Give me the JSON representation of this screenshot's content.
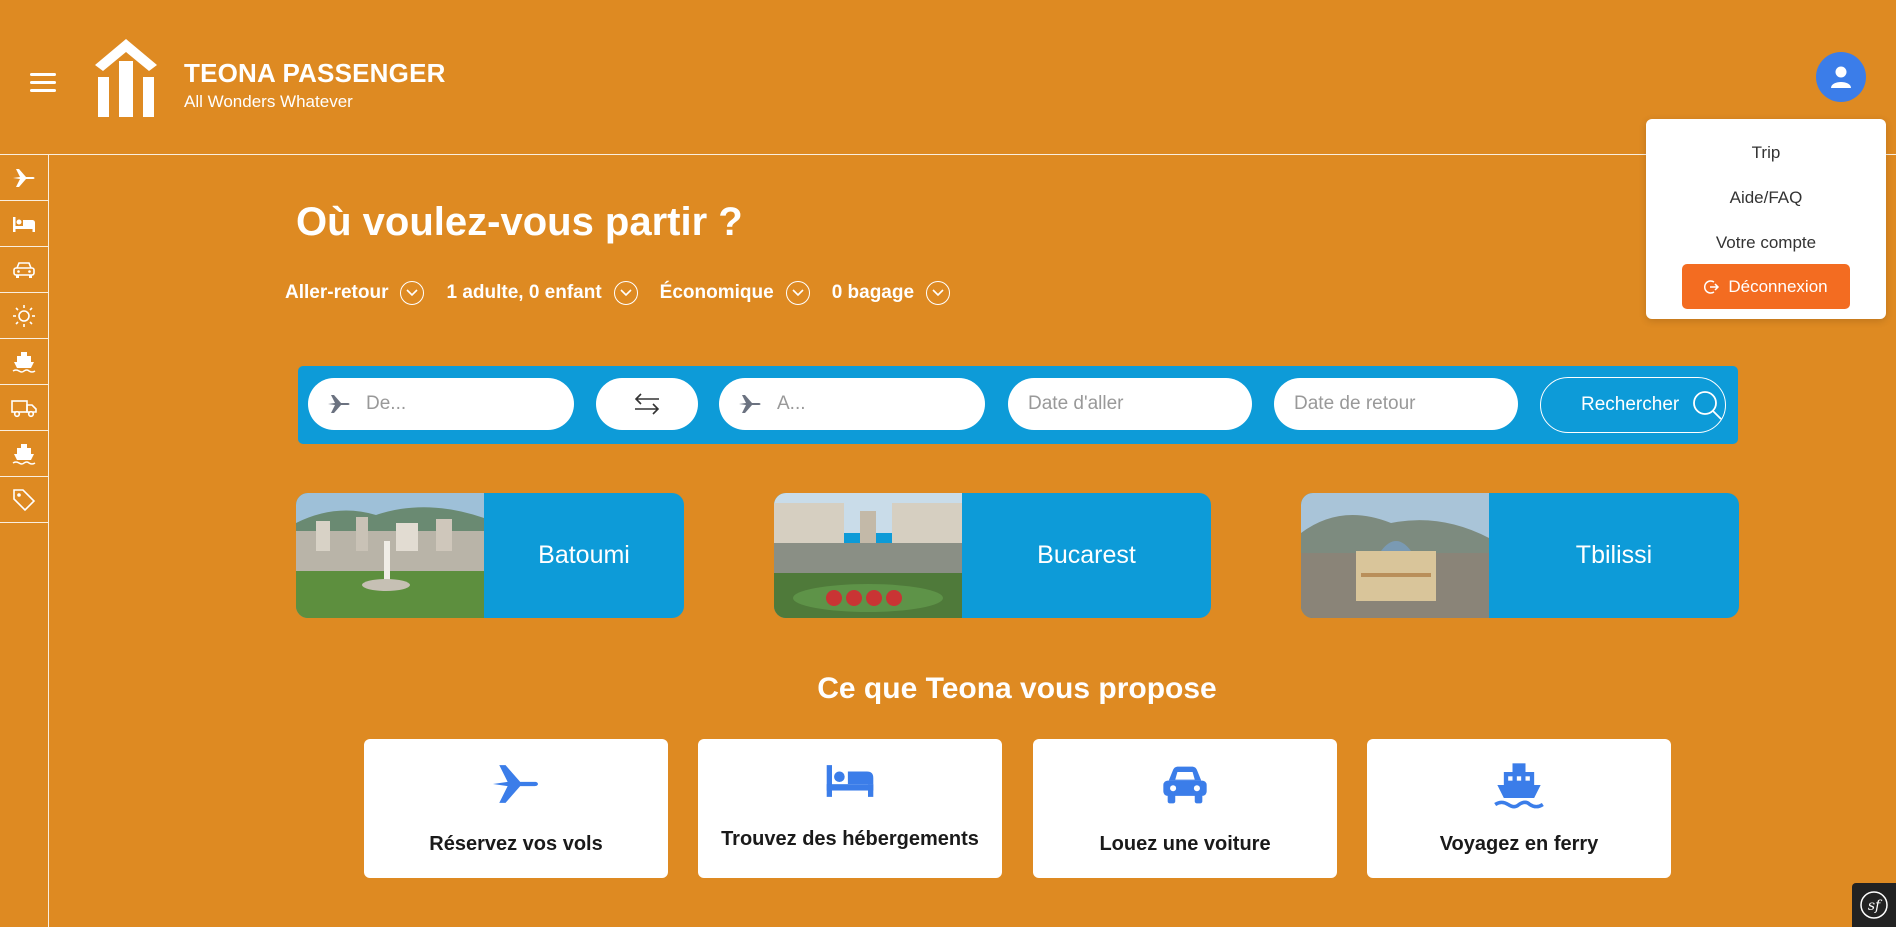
{
  "header": {
    "brand_name": "TEONA PASSENGER",
    "brand_tagline": "All Wonders Whatever",
    "avatar_color": "#3b7de9"
  },
  "user_menu": {
    "items": [
      "Trip",
      "Aide/FAQ",
      "Votre compte"
    ],
    "logout_label": "Déconnexion",
    "logout_color": "#f36c21"
  },
  "sidebar": {
    "items": [
      "plane-icon",
      "bed-icon",
      "car-icon",
      "sun-icon",
      "ferry-icon",
      "truck-icon",
      "ship-icon",
      "tag-icon"
    ]
  },
  "search": {
    "headline": "Où voulez-vous partir ?",
    "trip_type": "Aller-retour",
    "passengers": "1 adulte, 0 enfant",
    "cabin_class": "Économique",
    "baggage": "0 bagage",
    "from_placeholder": "De...",
    "to_placeholder": "A...",
    "depart_placeholder": "Date d'aller",
    "return_placeholder": "Date de retour",
    "submit_label": "Rechercher",
    "bar_color": "#0d9bd8"
  },
  "destinations": [
    "Batoumi",
    "Bucarest",
    "Tbilissi"
  ],
  "services": {
    "title": "Ce que Teona vous propose",
    "items": [
      {
        "label": "Réservez vos vols",
        "icon": "plane-icon"
      },
      {
        "label": "Trouvez des hébergements",
        "icon": "bed-icon"
      },
      {
        "label": "Louez une voiture",
        "icon": "car-icon"
      },
      {
        "label": "Voyagez en ferry",
        "icon": "ferry-icon"
      }
    ],
    "icon_color": "#3b7de9"
  },
  "page": {
    "background_color": "#de8a22"
  }
}
